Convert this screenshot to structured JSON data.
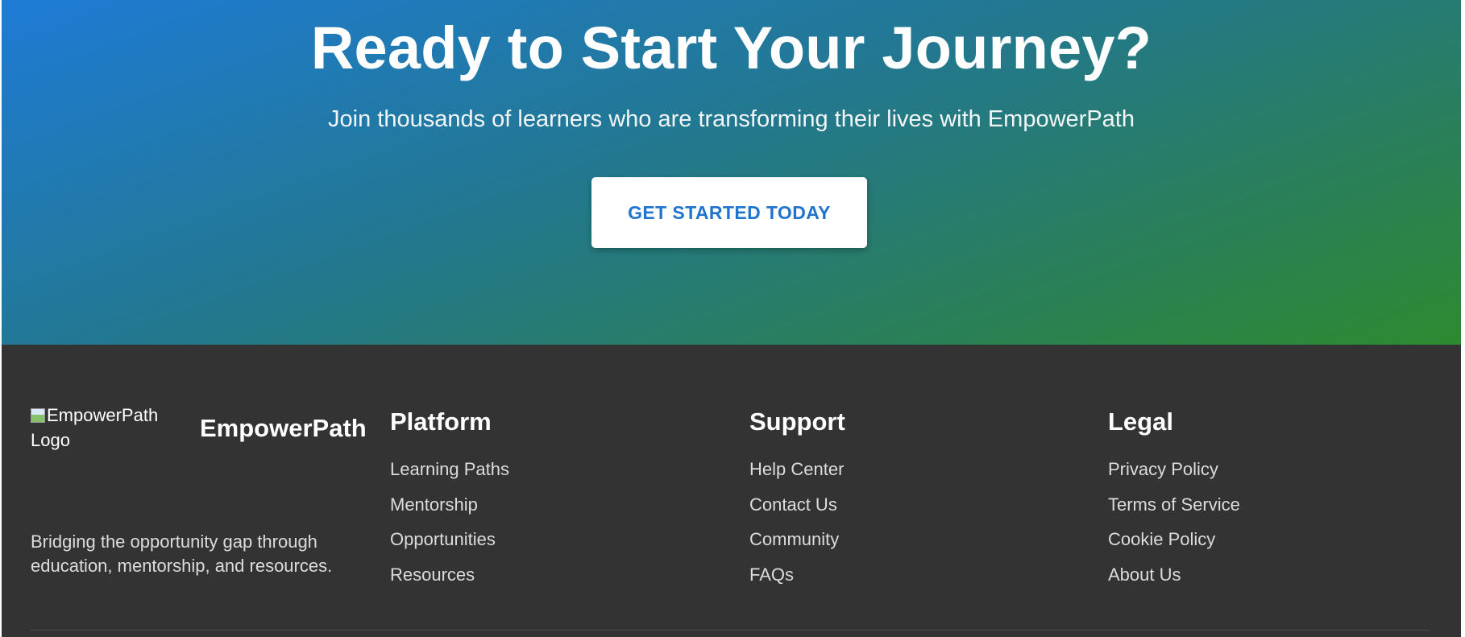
{
  "cta": {
    "title": "Ready to Start Your Journey?",
    "subtitle": "Join thousands of learners who are transforming their lives with EmpowerPath",
    "button_label": "GET STARTED TODAY"
  },
  "footer": {
    "brand": {
      "logo_alt": "EmpowerPath Logo",
      "name": "EmpowerPath",
      "description": "Bridging the opportunity gap through education, mentorship, and resources."
    },
    "columns": [
      {
        "title": "Platform",
        "links": [
          "Learning Paths",
          "Mentorship",
          "Opportunities",
          "Resources"
        ]
      },
      {
        "title": "Support",
        "links": [
          "Help Center",
          "Contact Us",
          "Community",
          "FAQs"
        ]
      },
      {
        "title": "Legal",
        "links": [
          "Privacy Policy",
          "Terms of Service",
          "Cookie Policy",
          "About Us"
        ]
      }
    ]
  },
  "colors": {
    "gradient_start": "#1e7bd6",
    "gradient_end": "#2e8a30",
    "button_text": "#1f74cf",
    "footer_bg": "#333333"
  }
}
